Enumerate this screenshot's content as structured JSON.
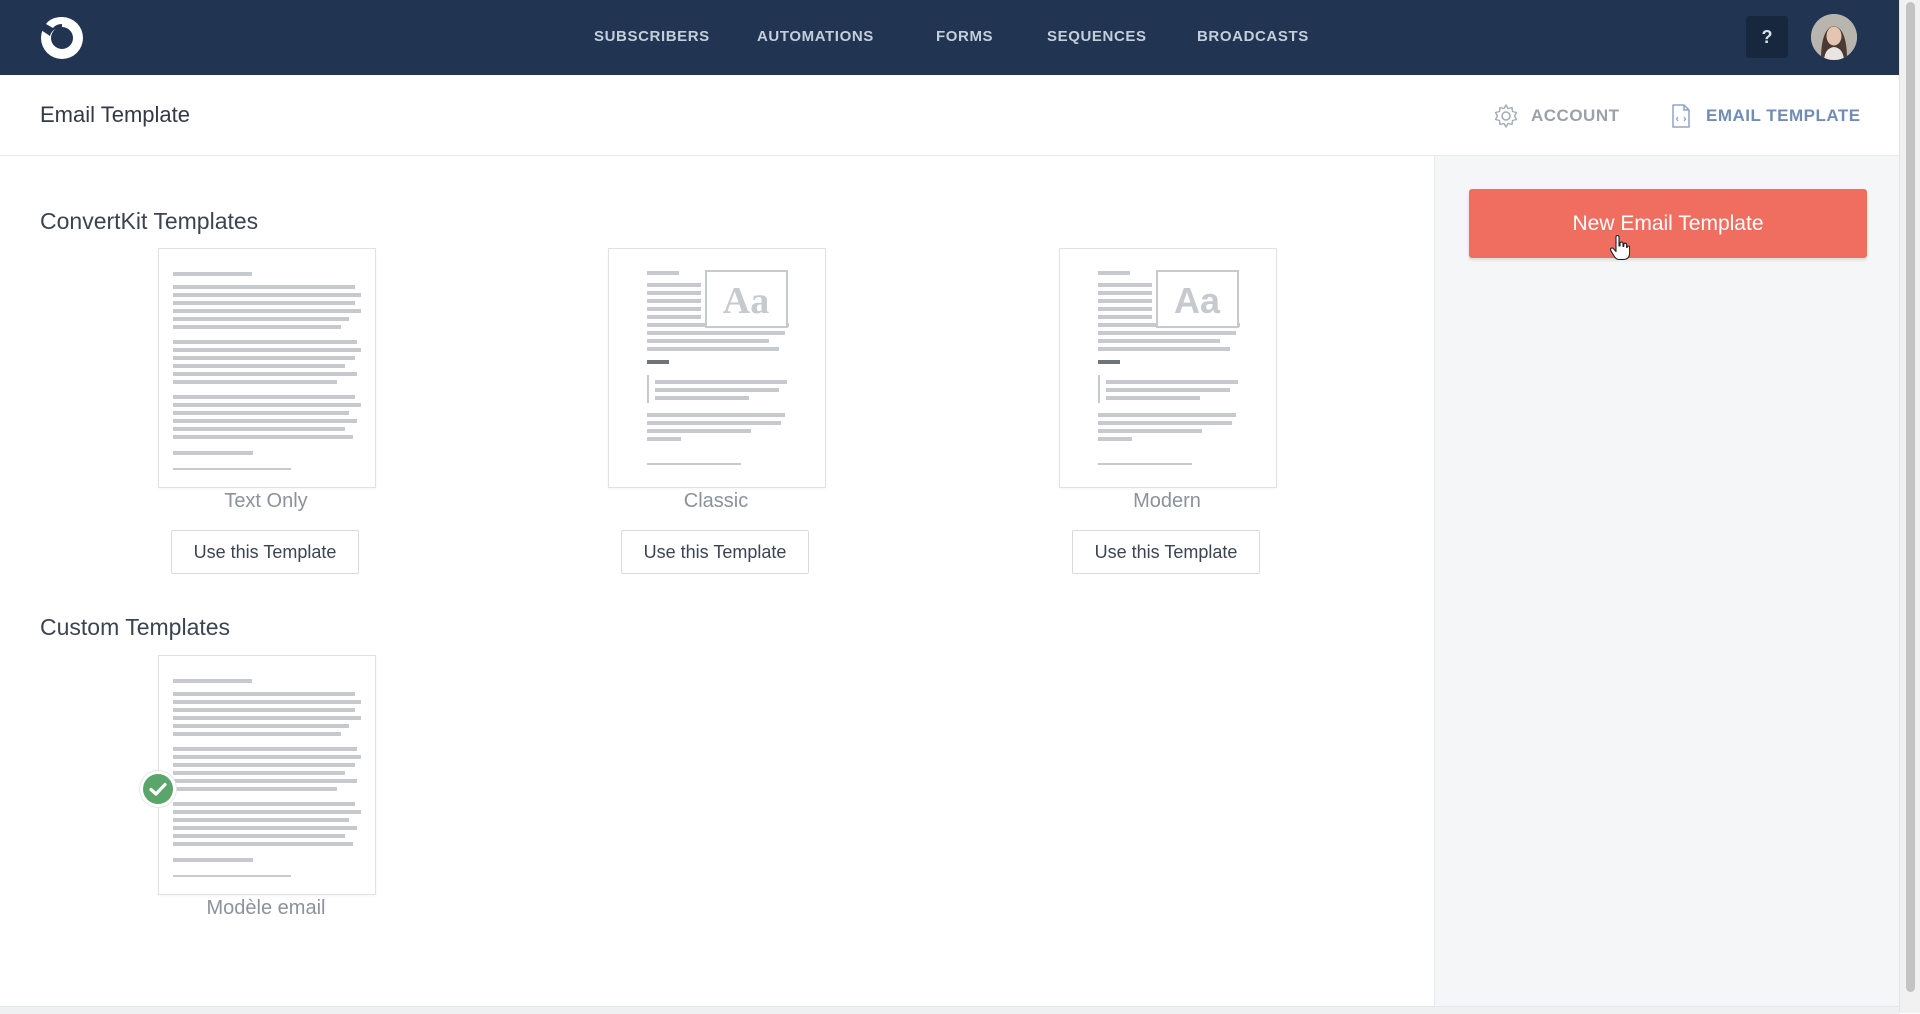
{
  "app": {
    "logo_icon": "convertkit-logo-icon"
  },
  "nav": {
    "items": [
      {
        "label": "SUBSCRIBERS"
      },
      {
        "label": "AUTOMATIONS"
      },
      {
        "label": "FORMS"
      },
      {
        "label": "SEQUENCES"
      },
      {
        "label": "BROADCASTS"
      }
    ],
    "help_label": "?",
    "avatar_icon": "user-avatar"
  },
  "subheader": {
    "title": "Email Template",
    "account_label": "ACCOUNT",
    "account_icon": "gear-icon",
    "email_template_label": "EMAIL TEMPLATE",
    "email_template_icon": "document-code-icon"
  },
  "convertkit_section": {
    "title": "ConvertKit Templates",
    "templates": [
      {
        "name": "Text Only",
        "button": "Use this Template",
        "preview": "text-only"
      },
      {
        "name": "Classic",
        "button": "Use this Template",
        "preview": "classic"
      },
      {
        "name": "Modern",
        "button": "Use this Template",
        "preview": "modern"
      }
    ]
  },
  "custom_section": {
    "title": "Custom Templates",
    "templates": [
      {
        "name": "Modèle email",
        "preview": "text-only",
        "selected": true
      }
    ]
  },
  "sidebar": {
    "new_button_label": "New Email Template"
  },
  "preview_placeholder_text": "Aa",
  "colors": {
    "nav_bg": "#213553",
    "accent_button": "#ef6e5f",
    "active_link": "#6f8db5",
    "check_green": "#5aa66a",
    "sidebar_bg": "#f4f6f8"
  }
}
